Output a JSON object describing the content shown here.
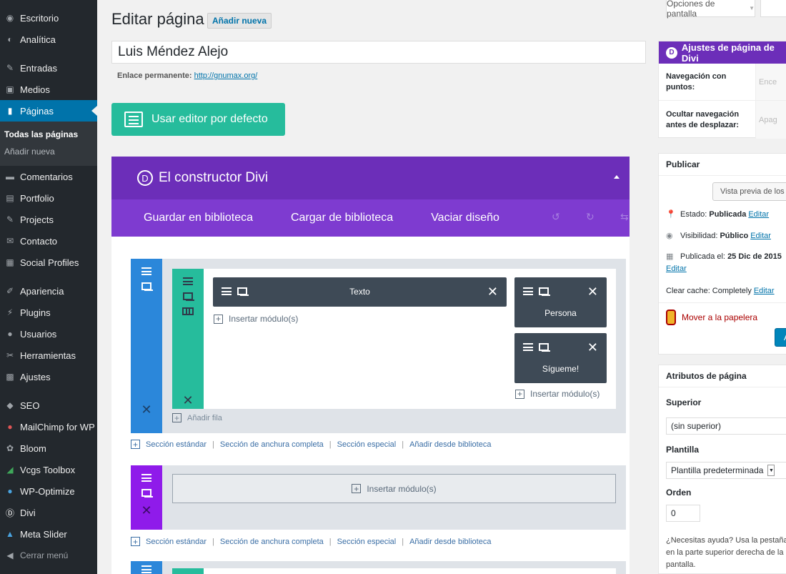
{
  "sidebar": {
    "items": [
      {
        "label": "Escritorio",
        "icon": "dashboard-icon"
      },
      {
        "label": "Analítica",
        "icon": "analytics-icon"
      },
      {
        "label": "Entradas",
        "icon": "pin-icon"
      },
      {
        "label": "Medios",
        "icon": "media-icon"
      },
      {
        "label": "Páginas",
        "icon": "pages-icon"
      },
      {
        "label": "Comentarios",
        "icon": "comments-icon"
      },
      {
        "label": "Portfolio",
        "icon": "portfolio-icon"
      },
      {
        "label": "Projects",
        "icon": "pin-icon"
      },
      {
        "label": "Contacto",
        "icon": "mail-icon"
      },
      {
        "label": "Social Profiles",
        "icon": "social-icon"
      },
      {
        "label": "Apariencia",
        "icon": "brush-icon"
      },
      {
        "label": "Plugins",
        "icon": "plugin-icon"
      },
      {
        "label": "Usuarios",
        "icon": "users-icon"
      },
      {
        "label": "Herramientas",
        "icon": "tools-icon"
      },
      {
        "label": "Ajustes",
        "icon": "settings-icon"
      },
      {
        "label": "SEO",
        "icon": "seo-icon"
      },
      {
        "label": "MailChimp for WP",
        "icon": "mailchimp-icon"
      },
      {
        "label": "Bloom",
        "icon": "bloom-icon"
      },
      {
        "label": "Vcgs Toolbox",
        "icon": "toolbox-icon"
      },
      {
        "label": "WP-Optimize",
        "icon": "optimize-icon"
      },
      {
        "label": "Divi",
        "icon": "divi-icon"
      },
      {
        "label": "Meta Slider",
        "icon": "slider-icon"
      }
    ],
    "submenu": [
      "Todas las páginas",
      "Añadir nueva"
    ],
    "collapse": "Cerrar menú"
  },
  "header": {
    "title": "Editar página",
    "add_new": "Añadir nueva",
    "screen_options": "Opciones de pantalla"
  },
  "post": {
    "title": "Luis Méndez Alejo",
    "permalink_label": "Enlace permanente:",
    "permalink_url": "http://gnumax.org/",
    "default_editor": "Usar editor por defecto"
  },
  "divi": {
    "title": "El constructor Divi",
    "logo": "D",
    "save": "Guardar en biblioteca",
    "load": "Cargar de biblioteca",
    "clear": "Vaciar diseño",
    "modules": {
      "texto": "Texto",
      "persona": "Persona",
      "sigueme": "Sígueme!"
    },
    "insert": "Insertar módulo(s)",
    "add_row": "Añadir fila",
    "links": [
      "Sección estándar",
      "Sección de anchura completa",
      "Sección especial",
      "Añadir desde biblioteca"
    ],
    "colors": {
      "section_blue": "#2b87da",
      "section_purple": "#8f1bea",
      "row_green": "#26bc9c"
    }
  },
  "right": {
    "divi_settings_title": "Ajustes de página de Divi",
    "dot_nav_label": "Navegación con puntos:",
    "dot_nav_value": "Ence",
    "hide_nav_label": "Ocultar navegación antes de desplazar:",
    "hide_nav_value": "Apag",
    "publish_title": "Publicar",
    "preview_changes": "Vista previa de los",
    "status_label": "Estado:",
    "status_value": "Publicada",
    "visibility_label": "Visibilidad:",
    "visibility_value": "Público",
    "published_label": "Publicada el:",
    "published_value": "25 Dic de 2015",
    "edit": "Editar",
    "clear_cache_label": "Clear cache: Completely",
    "trash": "Mover a la papelera",
    "update_label": "A",
    "attributes_title": "Atributos de página",
    "parent_label": "Superior",
    "parent_value": "(sin superior)",
    "template_label": "Plantilla",
    "template_value": "Plantilla predeterminada",
    "order_label": "Orden",
    "order_value": "0",
    "help_text": "¿Necesitas ayuda? Usa la pestaña en la parte superior derecha de la pantalla."
  }
}
